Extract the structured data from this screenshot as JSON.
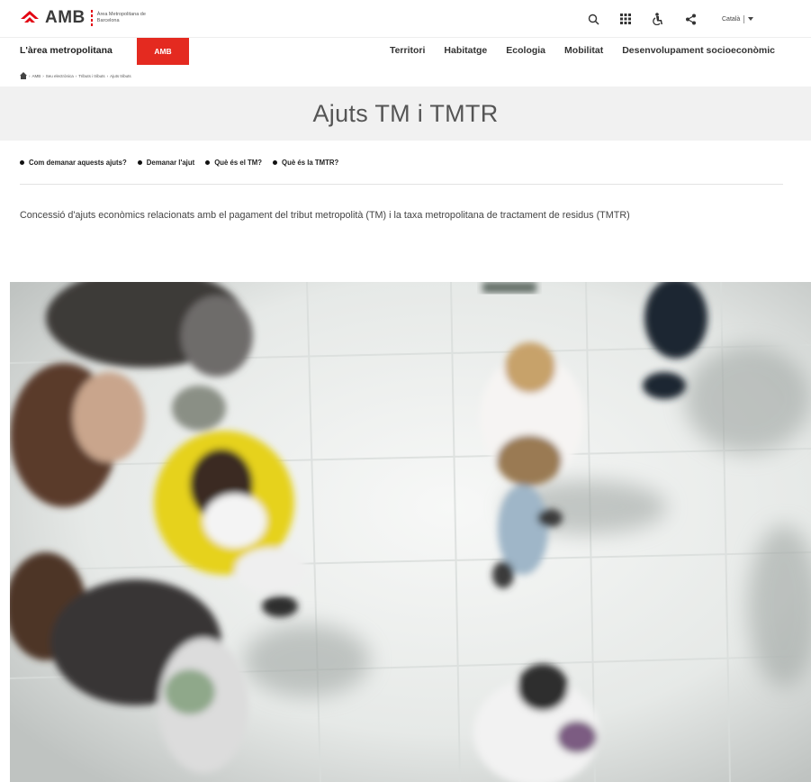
{
  "header": {
    "logo_text": "AMB",
    "logo_subtitle": "Àrea Metropolitana de Barcelona",
    "language": "Català",
    "icons": [
      "search-icon",
      "apps-grid-icon",
      "accessibility-icon",
      "share-icon",
      "chevron-down-icon"
    ]
  },
  "nav": {
    "home_label": "L'àrea metropolitana",
    "amb_tag": "AMB",
    "items": [
      {
        "label": "Territori"
      },
      {
        "label": "Habitatge"
      },
      {
        "label": "Ecologia"
      },
      {
        "label": "Mobilitat"
      },
      {
        "label": "Desenvolupament socioeconòmic"
      }
    ]
  },
  "breadcrumb": {
    "items": [
      "AMB",
      "Seu electrònica",
      "Tributs i tributs",
      "Ajuts tributs"
    ]
  },
  "page": {
    "title": "Ajuts TM i TMTR",
    "anchors": [
      {
        "label": "Com demanar aquests ajuts?"
      },
      {
        "label": "Demanar l'ajut"
      },
      {
        "label": "Què és el TM?"
      },
      {
        "label": "Què és la TMTR?"
      }
    ],
    "description": "Concessió d'ajuts econòmics relacionats amb el pagament del tribut metropolità (TM) i la taxa metropolitana de tractament de residus (TMTR)"
  },
  "colors": {
    "brand_red": "#e42a20",
    "title_band": "#f1f1f1"
  }
}
